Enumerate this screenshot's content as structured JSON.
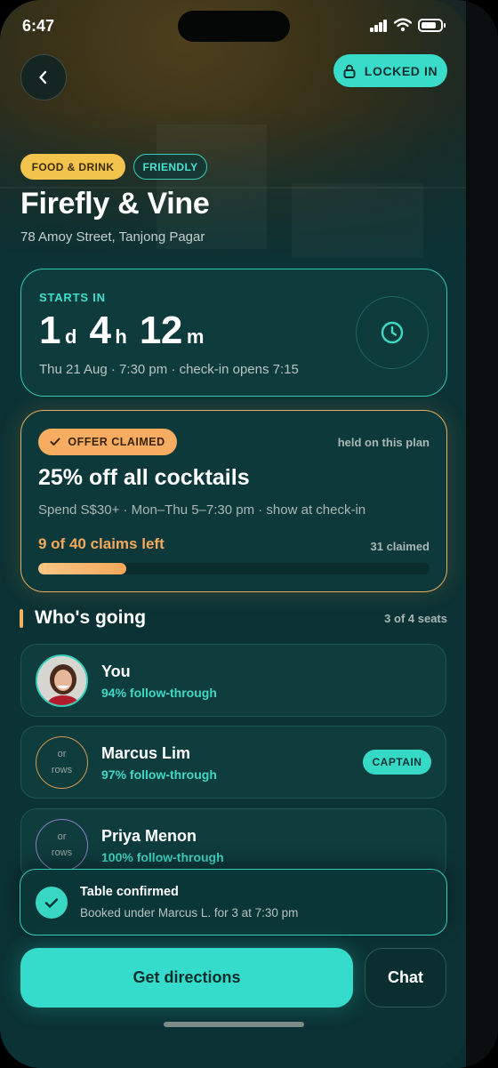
{
  "status_bar": {
    "time": "6:47"
  },
  "header": {
    "locked_label": "LOCKED IN"
  },
  "venue": {
    "tags": [
      "FOOD & DRINK",
      "FRIENDLY"
    ],
    "name": "Firefly & Vine",
    "address": "78 Amoy Street, Tanjong Pagar"
  },
  "countdown": {
    "label": "STARTS IN",
    "days": "1",
    "days_unit": "d",
    "hours": "4",
    "hours_unit": "h",
    "minutes": "12",
    "minutes_unit": "m",
    "details": "Thu 21 Aug · 7:30 pm · check-in opens 7:15"
  },
  "offer": {
    "badge": "OFFER CLAIMED",
    "held_note": "held on this plan",
    "title": "25% off all cocktails",
    "terms": "Spend S$30+ · Mon–Thu 5–7:30 pm · show at check-in",
    "claims_left": "9 of 40 claims left",
    "claimed": "31 claimed",
    "progress_fraction": 0.225,
    "accent_color": "#f5a95b"
  },
  "attendees": {
    "title": "Who's going",
    "seats": "3 of 4 seats",
    "members": [
      {
        "name": "You",
        "follow_through": "94% follow-through"
      },
      {
        "name": "Marcus Lim",
        "follow_through": "97% follow-through",
        "badge": "CAPTAIN"
      },
      {
        "name": "Priya Menon",
        "follow_through": "100% follow-through"
      }
    ],
    "broken_avatar_text": [
      "or",
      "rows"
    ]
  },
  "toast": {
    "title": "Table confirmed",
    "subtitle": "Booked under Marcus L. for 3 at 7:30 pm"
  },
  "actions": {
    "primary": "Get directions",
    "secondary": "Chat"
  },
  "theme": {
    "accent": "#36dccb",
    "tag_food": "#f2c44e",
    "background": "#0b3234"
  },
  "icons": [
    "chevron-left-icon",
    "lock-icon",
    "clock-icon",
    "check-icon",
    "signal-icon",
    "wifi-icon",
    "battery-icon"
  ]
}
